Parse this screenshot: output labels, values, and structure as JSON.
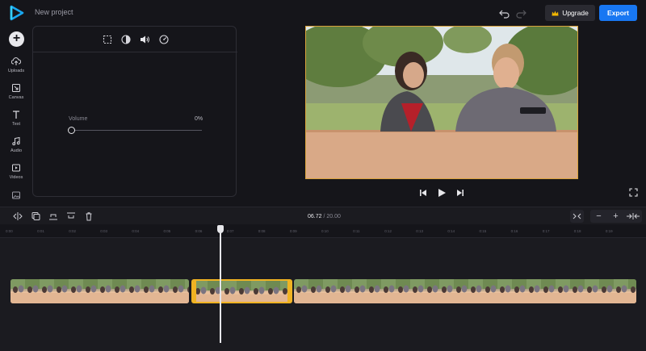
{
  "header": {
    "project_name": "New project",
    "upgrade_label": "Upgrade",
    "export_label": "Export"
  },
  "sidebar": {
    "items": [
      {
        "label": "Uploads",
        "icon": "upload-icon"
      },
      {
        "label": "Canvas",
        "icon": "canvas-icon"
      },
      {
        "label": "Text",
        "icon": "text-icon"
      },
      {
        "label": "Audio",
        "icon": "music-icon"
      },
      {
        "label": "Videos",
        "icon": "video-icon"
      },
      {
        "label": "",
        "icon": "image-icon"
      }
    ]
  },
  "panel": {
    "tabs": [
      "crop-icon",
      "adjust-icon",
      "volume-icon",
      "speed-icon"
    ],
    "active_tab": "volume-icon",
    "volume_label": "Volume",
    "volume_value": "0%",
    "volume_level": 0
  },
  "timeline": {
    "current_time": "06.72",
    "separator": "/",
    "duration": "20.00",
    "ticks": [
      "0:00",
      "0:01",
      "0:02",
      "0:03",
      "0:04",
      "0:05",
      "0:06",
      "0:07",
      "0:08",
      "0:09",
      "0:10",
      "0:11",
      "0:12",
      "0:13",
      "0:14",
      "0:15",
      "0:16",
      "0:17",
      "0:18",
      "0:19"
    ],
    "zoom_out": "−",
    "zoom_in": "+"
  },
  "colors": {
    "accent": "#1877f2",
    "selection": "#f0b323",
    "background": "#15151a"
  }
}
